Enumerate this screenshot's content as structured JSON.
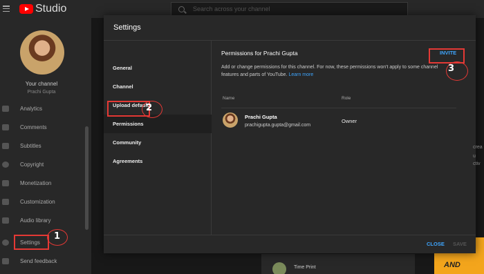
{
  "header": {
    "app_name": "Studio",
    "search_placeholder": "Search across your channel"
  },
  "sidebar": {
    "your_channel": "Your channel",
    "channel_name": "Prachi Gupta",
    "items": [
      {
        "label": "Analytics",
        "icon": "analytics-icon"
      },
      {
        "label": "Comments",
        "icon": "comments-icon"
      },
      {
        "label": "Subtitles",
        "icon": "subtitles-icon"
      },
      {
        "label": "Copyright",
        "icon": "copyright-icon"
      },
      {
        "label": "Monetization",
        "icon": "monetization-icon"
      },
      {
        "label": "Customization",
        "icon": "customization-icon"
      },
      {
        "label": "Audio library",
        "icon": "audio-library-icon"
      },
      {
        "label": "Settings",
        "icon": "gear-icon"
      },
      {
        "label": "Send feedback",
        "icon": "feedback-icon"
      }
    ]
  },
  "modal": {
    "title": "Settings",
    "tabs": [
      {
        "label": "General"
      },
      {
        "label": "Channel"
      },
      {
        "label": "Upload defaults"
      },
      {
        "label": "Permissions"
      },
      {
        "label": "Community"
      },
      {
        "label": "Agreements"
      }
    ],
    "active_tab": "Permissions",
    "permissions": {
      "title": "Permissions for Prachi Gupta",
      "invite_label": "INVITE",
      "description": "Add or change permissions for this channel. For now, these permissions won't apply to some channel features and parts of YouTube.",
      "learn_more": "Learn more",
      "columns": {
        "name": "Name",
        "role": "Role"
      },
      "rows": [
        {
          "name": "Prachi Gupta",
          "email": "prachigupta.gupta@gmail.com",
          "role": "Owner"
        }
      ]
    },
    "close_label": "CLOSE",
    "save_label": "SAVE"
  },
  "background": {
    "card_title": "Time Print"
  },
  "annotations": [
    "1",
    "2",
    "3"
  ],
  "colors": {
    "accent_blue": "#3ea6ff",
    "annotation_red": "#e53935",
    "youtube_red": "#ff0000"
  }
}
